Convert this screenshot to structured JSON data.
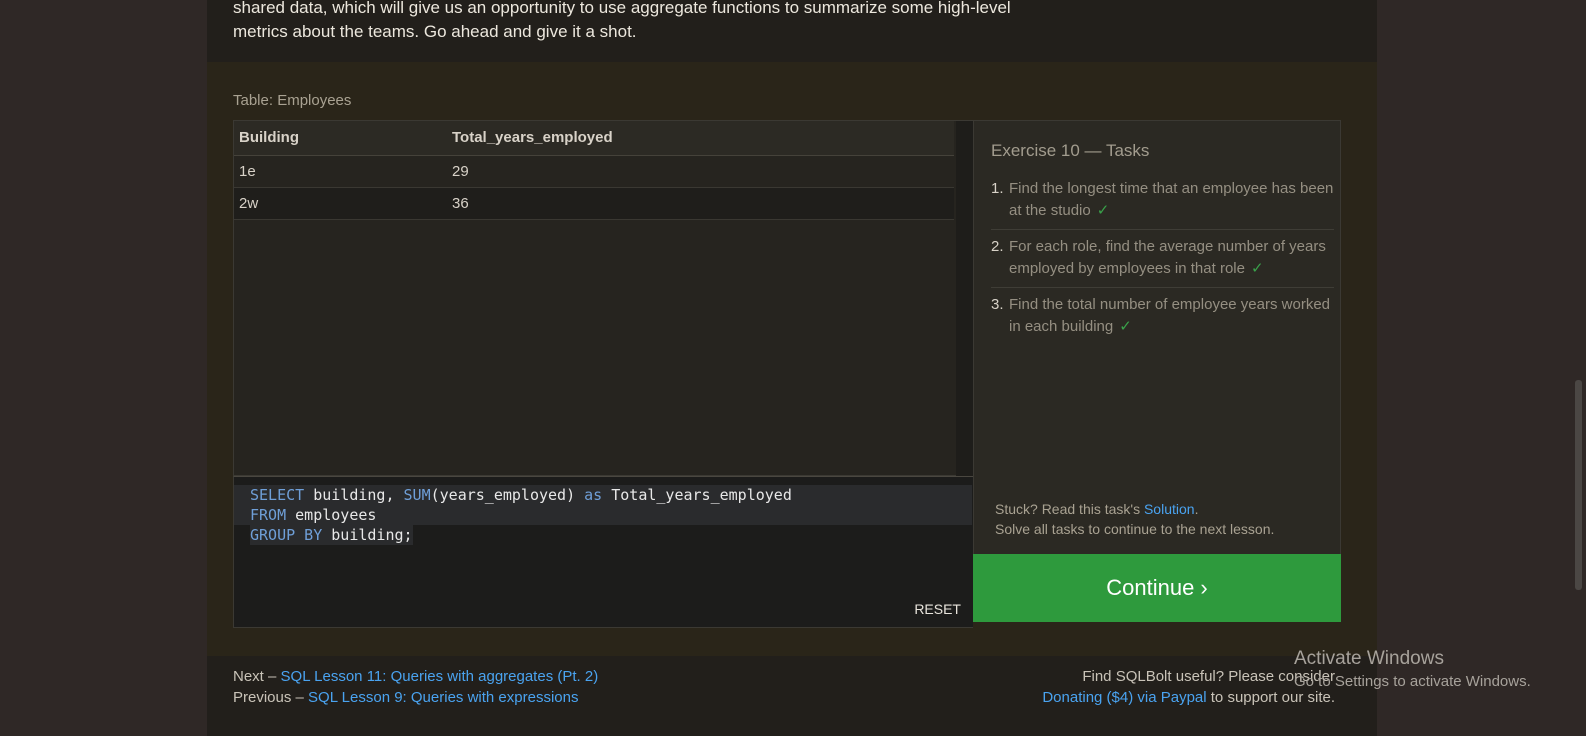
{
  "intro": {
    "line1": "shared data, which will give us an opportunity to use aggregate functions to summarize some high-level",
    "line2": "metrics about the teams. Go ahead and give it a shot."
  },
  "exercise": {
    "table_caption": "Table: Employees",
    "columns": [
      "Building",
      "Total_years_employed"
    ],
    "rows": [
      [
        "1e",
        "29"
      ],
      [
        "2w",
        "36"
      ]
    ],
    "code": {
      "line1": {
        "kw1": "SELECT",
        "t1": " building, ",
        "kw2": "SUM",
        "t2": "(years_employed) ",
        "kw3": "as",
        "t3": " Total_years_employed"
      },
      "line2": {
        "kw1": "FROM",
        "t1": " employees"
      },
      "line3": {
        "kw1": "GROUP BY",
        "t1": " building;"
      }
    },
    "reset_label": "RESET"
  },
  "tasks": {
    "title": "Exercise 10 — Tasks",
    "items": [
      {
        "num": "1.",
        "text": "Find the longest time that an employee has been at the studio",
        "check": "✓"
      },
      {
        "num": "2.",
        "text": "For each role, find the average number of years employed by employees in that role",
        "check": "✓"
      },
      {
        "num": "3.",
        "text": "Find the total number of employee years worked in each building",
        "check": "✓"
      }
    ],
    "stuck_prefix": "Stuck? Read this task's ",
    "solution_link": "Solution",
    "stuck_suffix": ".",
    "solve_all": "Solve all tasks to continue to the next lesson.",
    "continue_label": "Continue ›"
  },
  "footer": {
    "next_prefix": "Next – ",
    "next_link": "SQL Lesson 11: Queries with aggregates (Pt. 2)",
    "prev_prefix": "Previous – ",
    "prev_link": "SQL Lesson 9: Queries with expressions",
    "useful_text": "Find SQLBolt useful? Please consider",
    "donate_link": "Donating ($4) via Paypal",
    "donate_suffix": " to support our site."
  },
  "watermark": {
    "title": "Activate Windows",
    "subtitle": "Go to Settings to activate Windows."
  },
  "colors": {
    "continue": "#2e9a3d",
    "link": "#4aa3f0",
    "keyword": "#6f9fd8",
    "check": "#39a14a"
  }
}
